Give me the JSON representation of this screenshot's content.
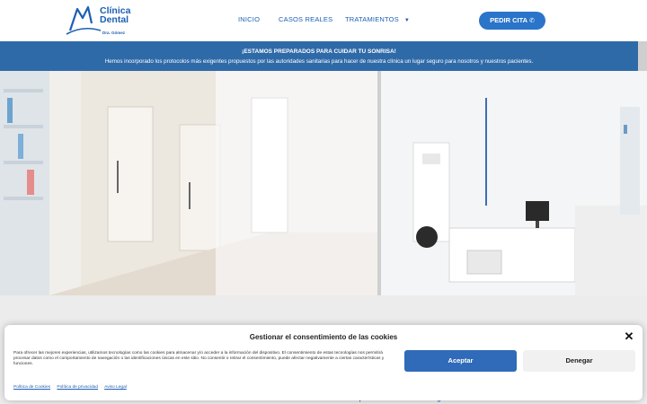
{
  "brand": {
    "line1": "Clínica",
    "line2": "Dental",
    "sub": "Dra. Gómez"
  },
  "nav": {
    "items": [
      {
        "label": "INICIO"
      },
      {
        "label": "CASOS REALES"
      },
      {
        "label": "TRATAMIENTOS",
        "has_dropdown": true
      }
    ],
    "cta_label": "PEDIR CITA"
  },
  "announcement": {
    "title": "¡ESTAMOS PREPARADOS PARA CUIDAR TU SONRISA!",
    "text": "Hemos incorporado los protocolos más exigentes propuestos por las autoridades sanitarias para hacer de nuestra clínica un lugar seguro para nosotros y nuestros pacientes."
  },
  "slider": {
    "slide_count": 4,
    "active_index": 1
  },
  "behind_text": "materiales para ofrecer una odontología de la más alta calidad.»",
  "cookie_modal": {
    "title": "Gestionar el consentimiento de las cookies",
    "body": "Para ofrecer las mejores experiencias, utilizamos tecnologías como las cookies para almacenar y/o acceder a la información del dispositivo. El consentimiento de estas tecnologías nos permitirá procesar datos como el comportamiento de navegación o las identificaciones únicas en este sitio. No consentir o retirar el consentimiento, puede afectar negativamente a ciertas características y funciones.",
    "accept_label": "Aceptar",
    "deny_label": "Denegar",
    "links": [
      "Política de Cookies",
      "Política de privacidad",
      "Aviso Legal"
    ]
  },
  "colors": {
    "brand_blue": "#1d5fb3",
    "band_blue": "#2f6aa8",
    "cta_blue": "#2a74c9"
  },
  "icons": {
    "cta": "whatsapp-icon",
    "close": "close-icon",
    "dropdown": "chevron-down-icon"
  }
}
